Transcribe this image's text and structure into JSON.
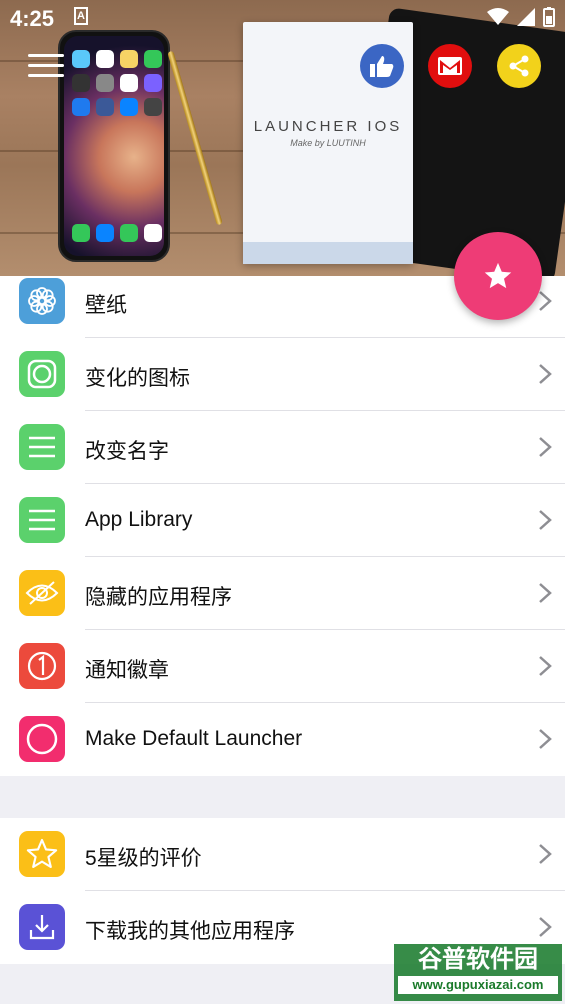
{
  "status_bar": {
    "time": "4:25",
    "notification_glyph": "A"
  },
  "header": {
    "card_title": "LAUNCHER IOS",
    "card_subtitle": "Make by LUUTINH",
    "social": [
      "thumbs-up-icon",
      "gmail-icon",
      "share-icon"
    ]
  },
  "menu_group_1": [
    {
      "label": "壁纸",
      "icon": "flower-icon",
      "color": "#4d9fd9"
    },
    {
      "label": "变化的图标",
      "icon": "rounded-square-icon",
      "color": "#5bd16c"
    },
    {
      "label": "改变名字",
      "icon": "lines-icon",
      "color": "#5bd16c"
    },
    {
      "label": "App Library",
      "icon": "lines-icon",
      "color": "#5bd16c"
    },
    {
      "label": "隐藏的应用程序",
      "icon": "eye-slash-icon",
      "color": "#fbbf17"
    },
    {
      "label": "通知徽章",
      "icon": "badge-one-icon",
      "color": "#ec4a3c"
    },
    {
      "label": "Make Default Launcher",
      "icon": "circle-icon",
      "color": "#f22d6e"
    }
  ],
  "menu_group_2": [
    {
      "label": "5星级的评价",
      "icon": "star-icon",
      "color": "#fbbf17"
    },
    {
      "label": "下载我的其他应用程序",
      "icon": "download-icon",
      "color": "#5a52d6"
    }
  ],
  "watermark": {
    "title": "谷普软件园",
    "url": "www.gupuxiazai.com"
  }
}
